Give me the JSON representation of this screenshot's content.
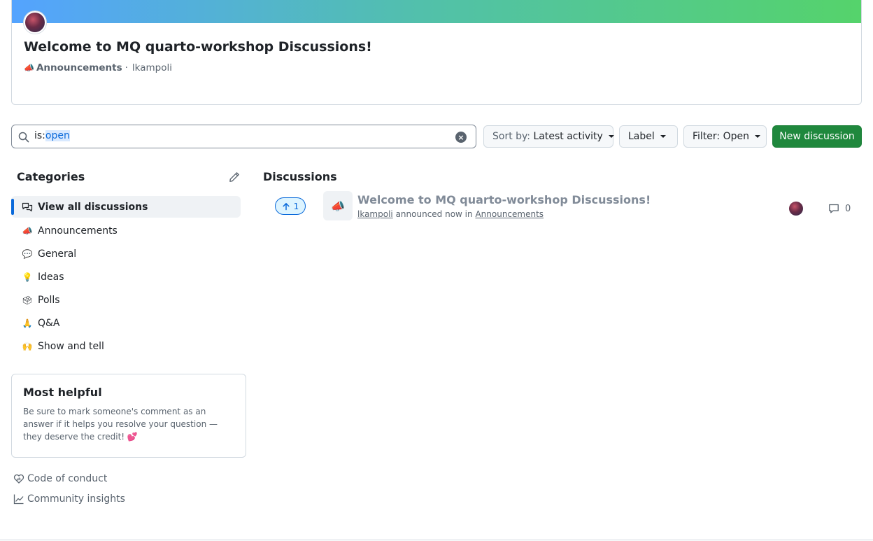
{
  "banner": {
    "title": "Welcome to MQ quarto-workshop Discussions!",
    "category_emoji": "📣",
    "category": "Announcements",
    "separator": "·",
    "author": "lkampoli",
    "gradient_start": "#54a3ff",
    "gradient_end": "#55d36b"
  },
  "toolbar": {
    "search_prefix": "is:",
    "search_highlight": "open",
    "sort_prefix": "Sort by:",
    "sort_value": "Latest activity",
    "label_button": "Label",
    "filter_button": "Filter: Open",
    "new_button": "New discussion"
  },
  "sidebar": {
    "heading": "Categories",
    "items": [
      {
        "emoji": "💬",
        "label": "View all discussions",
        "active": true
      },
      {
        "emoji": "📣",
        "label": "Announcements"
      },
      {
        "emoji": "💬",
        "label": "General"
      },
      {
        "emoji": "💡",
        "label": "Ideas"
      },
      {
        "emoji": "🗳",
        "label": "Polls"
      },
      {
        "emoji": "🙏",
        "label": "Q&A"
      },
      {
        "emoji": "🙌",
        "label": "Show and tell"
      }
    ],
    "helpful_title": "Most helpful",
    "helpful_text": "Be sure to mark someone's comment as an answer if it helps you resolve your question — they deserve the credit! 💕",
    "code_of_conduct": "Code of conduct",
    "community_insights": "Community insights"
  },
  "discussions": {
    "heading": "Discussions",
    "items": [
      {
        "votes": "1",
        "emoji": "📣",
        "title": "Welcome to MQ quarto-workshop Discussions!",
        "author": "lkampoli",
        "action": "announced now in",
        "category": "Announcements",
        "comments": "0"
      }
    ]
  },
  "colors": {
    "primary_button": "#1f883d",
    "accent": "#0969da",
    "muted_text": "#59636e"
  }
}
